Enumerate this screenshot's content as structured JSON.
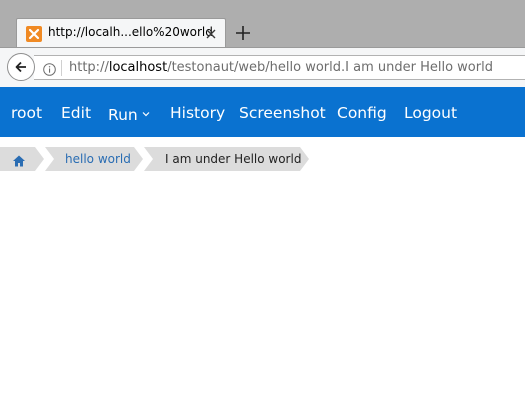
{
  "browser": {
    "tab": {
      "title": "http://localh...ello%20world",
      "favicon": "xampp-favicon-icon"
    },
    "new_tab": "plus-icon",
    "address": {
      "prefix": "http://",
      "host": "localhost",
      "path": "/testonaut/web/hello world.I am under Hello world"
    }
  },
  "menu": {
    "items": [
      {
        "label": "root"
      },
      {
        "label": "Edit"
      },
      {
        "label": "Run",
        "has_dropdown": true
      },
      {
        "label": "History"
      },
      {
        "label": "Screenshot"
      },
      {
        "label": "Config"
      },
      {
        "label": "Logout"
      }
    ],
    "background": "#0a72d0"
  },
  "breadcrumb": {
    "home_icon": "home-icon",
    "items": [
      {
        "label": "hello world"
      },
      {
        "label": "I am under Hello world"
      }
    ],
    "link_color": "#2a6db3"
  }
}
